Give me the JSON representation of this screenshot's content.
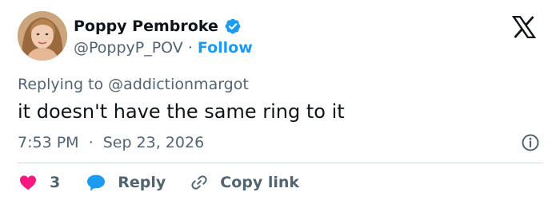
{
  "author": {
    "display_name": "Poppy Pembroke",
    "handle": "@PoppyP_POV",
    "separator": "·",
    "follow_label": "Follow",
    "verified_icon": "verified-badge-icon"
  },
  "reply": {
    "prefix": "Replying to",
    "target": "@addictionmargot"
  },
  "tweet": {
    "text": "it doesn't have the same ring to it",
    "time": "7:53 PM",
    "separator": "·",
    "date": "Sep 23, 2026"
  },
  "actions": {
    "like_count": "3",
    "reply_label": "Reply",
    "copy_label": "Copy link"
  },
  "colors": {
    "accent": "#1d9bf0",
    "like": "#f91880",
    "text": "#0f1419",
    "muted": "#536471",
    "divider": "#cfd9de"
  },
  "icons": [
    "x-logo-icon",
    "verified-badge-icon",
    "info-icon",
    "heart-icon",
    "reply-bubble-icon",
    "link-icon"
  ]
}
